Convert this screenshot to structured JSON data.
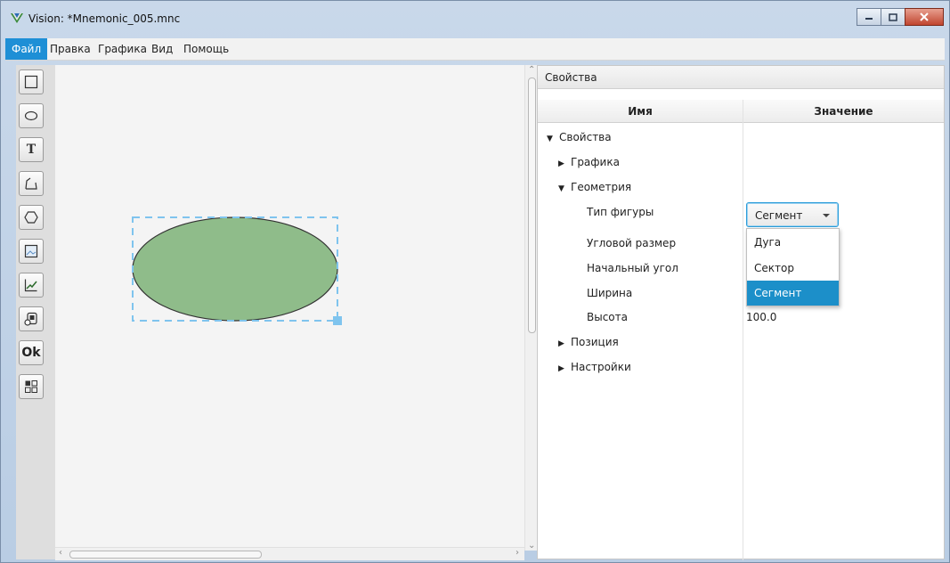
{
  "window": {
    "title": "Vision: *Mnemonic_005.mnc",
    "controls": [
      "minimize",
      "maximize",
      "close"
    ]
  },
  "menu": {
    "items": [
      "Файл",
      "Правка",
      "Графика",
      "Вид",
      "Помощь"
    ],
    "active": "Файл"
  },
  "toolbar": {
    "tools": [
      {
        "name": "rectangle-tool",
        "icon": "rectangle-icon"
      },
      {
        "name": "ellipse-tool",
        "icon": "ellipse-icon"
      },
      {
        "name": "text-tool",
        "icon": "text-icon",
        "glyph": "T"
      },
      {
        "name": "polyline-tool",
        "icon": "polyline-icon"
      },
      {
        "name": "polygon-tool",
        "icon": "hexagon-icon"
      },
      {
        "name": "image-tool",
        "icon": "image-icon"
      },
      {
        "name": "chart-tool",
        "icon": "chart-icon"
      },
      {
        "name": "indicator-tool",
        "icon": "indicator-icon"
      },
      {
        "name": "button-tool",
        "icon": "ok-button-icon",
        "glyph": "Ok"
      },
      {
        "name": "group-tool",
        "icon": "grid-icon"
      }
    ]
  },
  "canvas": {
    "shape": {
      "type": "ellipse",
      "fill": "#8fbc8a",
      "stroke": "#333333",
      "selected": true,
      "selection_color": "#7fc4ee"
    }
  },
  "properties": {
    "header": "Свойства",
    "columns": {
      "name": "Имя",
      "value": "Значение"
    },
    "tree": {
      "root": "Свойства",
      "graphics": "Графика",
      "geometry": "Геометрия",
      "shape_type": "Тип фигуры",
      "angular_size": "Угловой размер",
      "start_angle": "Начальный угол",
      "width": "Ширина",
      "height": "Высота",
      "height_value": "100.0",
      "position": "Позиция",
      "settings": "Настройки"
    },
    "shape_type_combo": {
      "value": "Сегмент",
      "options": [
        "Дуга",
        "Сектор",
        "Сегмент"
      ]
    }
  },
  "colors": {
    "accent": "#1e8fd6",
    "selected_option": "#1c8fc9"
  }
}
